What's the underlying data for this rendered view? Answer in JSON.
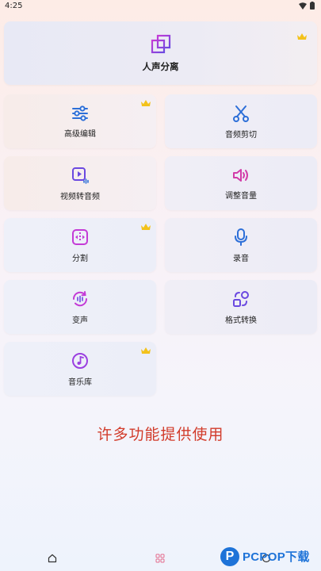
{
  "status_bar": {
    "time": "4:25"
  },
  "hero": {
    "label": "人声分离",
    "icon": "layers-icon",
    "premium": true
  },
  "tiles": [
    {
      "label": "高级编辑",
      "icon": "sliders-icon",
      "premium": true
    },
    {
      "label": "音频剪切",
      "icon": "scissors-icon",
      "premium": false
    },
    {
      "label": "视频转音频",
      "icon": "video-audio-icon",
      "premium": false
    },
    {
      "label": "调整音量",
      "icon": "volume-icon",
      "premium": false
    },
    {
      "label": "分割",
      "icon": "split-icon",
      "premium": true
    },
    {
      "label": "录音",
      "icon": "microphone-icon",
      "premium": false
    },
    {
      "label": "变声",
      "icon": "voice-change-icon",
      "premium": false
    },
    {
      "label": "格式转换",
      "icon": "format-convert-icon",
      "premium": false
    },
    {
      "label": "音乐库",
      "icon": "music-note-icon",
      "premium": true
    }
  ],
  "promo_text": "许多功能提供使用",
  "watermark": {
    "logo_letter": "P",
    "text": "PCPOP下载"
  },
  "colors": {
    "accent_purple": "#9b3fe0",
    "accent_blue": "#2d6fd8",
    "crown": "#f3c21b",
    "promo": "#d23b2a"
  }
}
